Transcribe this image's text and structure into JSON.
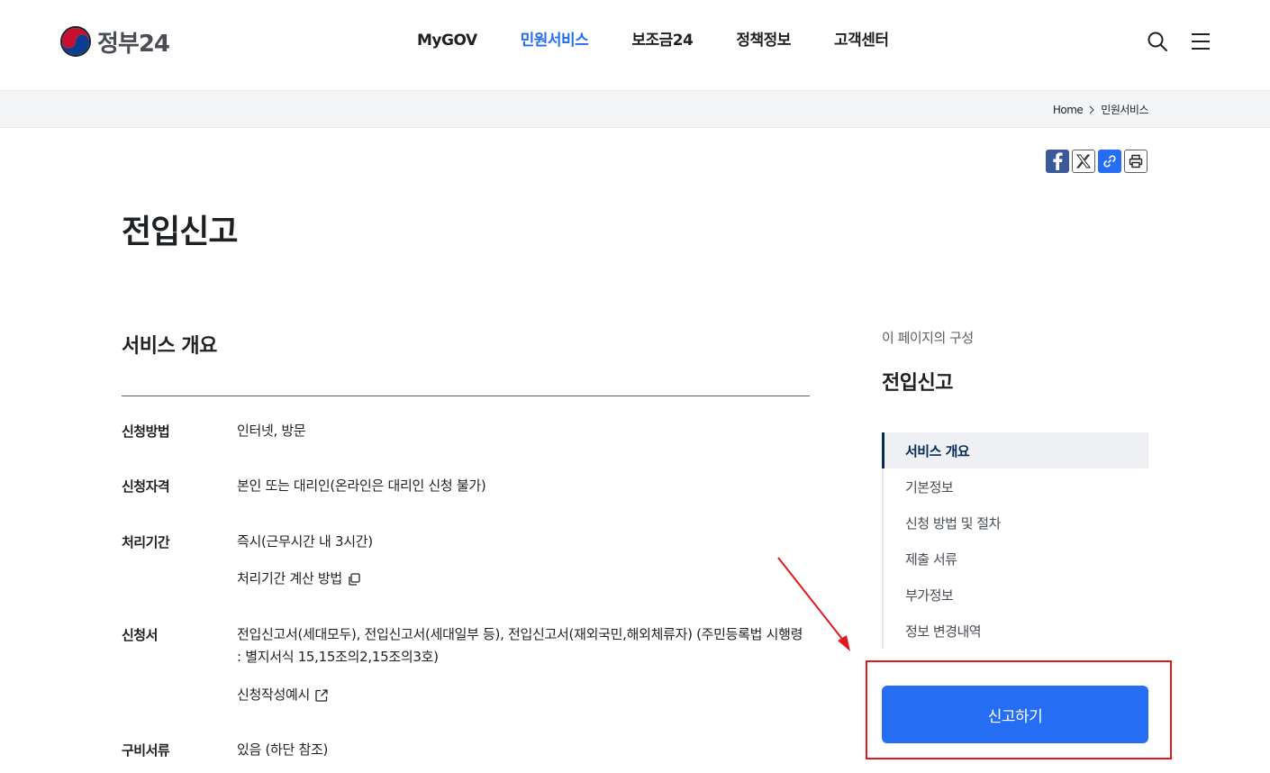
{
  "header": {
    "logo_text": "정부24",
    "nav": [
      {
        "label": "MyGOV",
        "active": false
      },
      {
        "label": "민원서비스",
        "active": true
      },
      {
        "label": "보조금24",
        "active": false
      },
      {
        "label": "정책정보",
        "active": false
      },
      {
        "label": "고객센터",
        "active": false
      }
    ],
    "icons": [
      "search-icon",
      "hamburger-menu-icon"
    ]
  },
  "breadcrumb": [
    "Home",
    "민원서비스"
  ],
  "share_icons": [
    "facebook-icon",
    "x-twitter-icon",
    "link-copy-icon",
    "print-icon"
  ],
  "page_title": "전입신고",
  "overview": {
    "title": "서비스 개요",
    "rows": [
      {
        "label": "신청방법",
        "value": "인터넷, 방문"
      },
      {
        "label": "신청자격",
        "value": "본인 또는 대리인(온라인은 대리인 신청 불가)"
      },
      {
        "label": "처리기간",
        "value": "즉시(근무시간 내 3시간)",
        "link": "처리기간 계산 방법"
      },
      {
        "label": "신청서",
        "value": "전입신고서(세대모두), 전입신고서(세대일부 등), 전입신고서(재외국민,해외체류자) (주민등록법 시행령 : 별지서식 15,15조의2,15조의3호)",
        "link": "신청작성예시"
      },
      {
        "label": "구비서류",
        "value": "있음 (하단 참조)"
      }
    ]
  },
  "toc": {
    "caption": "이 페이지의 구성",
    "title": "전입신고",
    "items": [
      "서비스 개요",
      "기본정보",
      "신청 방법 및 절차",
      "제출 서류",
      "부가정보",
      "정보 변경내역"
    ],
    "active_index": 0
  },
  "report_button": "신고하기",
  "colors": {
    "primary": "#256ef4",
    "nav_active": "#256ef4",
    "toc_active": "#052b57",
    "annotation": "#e0191b"
  }
}
